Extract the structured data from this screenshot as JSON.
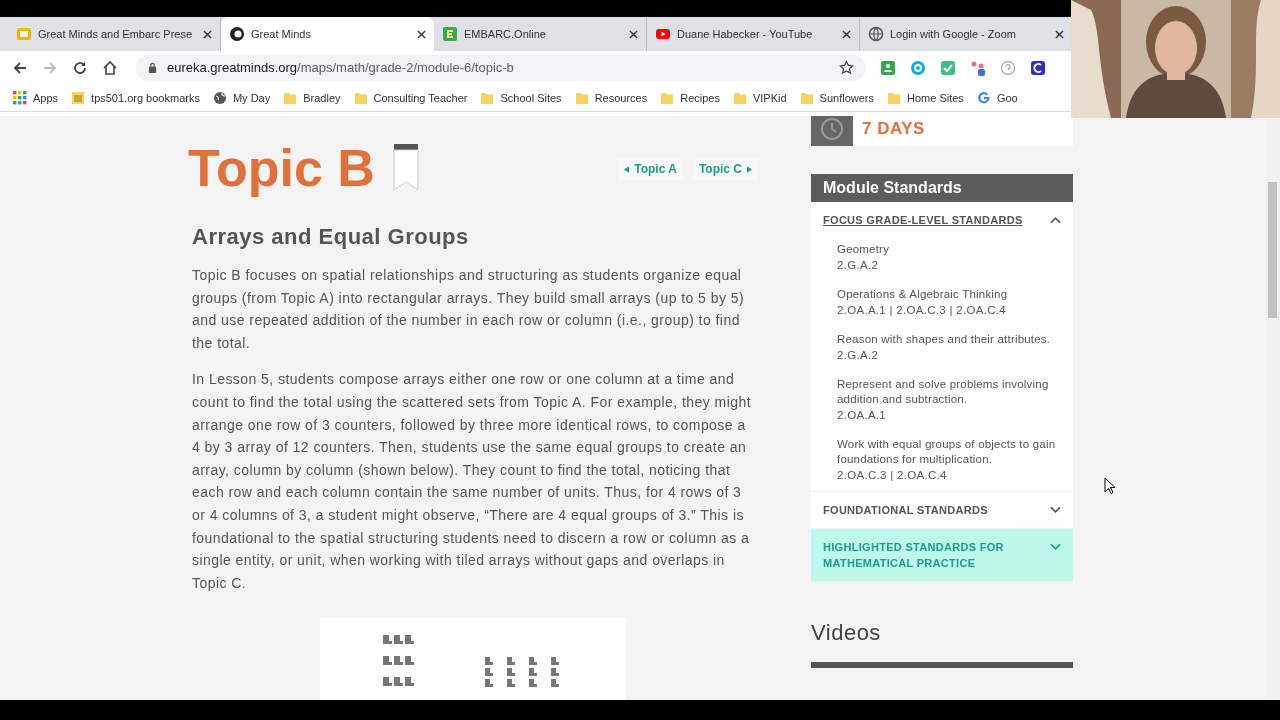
{
  "tabs": [
    {
      "title": "Great Minds and Embarc Prese",
      "kind": "slides",
      "selected": false
    },
    {
      "title": "Great Minds",
      "kind": "gm",
      "selected": true
    },
    {
      "title": "EMBARC.Online",
      "kind": "embarc",
      "selected": false
    },
    {
      "title": "Duane Habecker - YouTube",
      "kind": "youtube",
      "selected": false
    },
    {
      "title": "Login with Google - Zoom",
      "kind": "globe",
      "selected": false
    }
  ],
  "address_bar": {
    "host": "eureka.greatminds.org",
    "path": "/maps/math/grade-2/module-6/topic-b"
  },
  "bookmarks": [
    {
      "label": "Apps",
      "kind": "apps"
    },
    {
      "label": "tps501.org bookmarks",
      "kind": "page"
    },
    {
      "label": "My Day",
      "kind": "globe"
    },
    {
      "label": "Bradley",
      "kind": "folder"
    },
    {
      "label": "Consulting Teacher",
      "kind": "folder"
    },
    {
      "label": "School Sites",
      "kind": "folder"
    },
    {
      "label": "Resources",
      "kind": "folder"
    },
    {
      "label": "Recipes",
      "kind": "folder"
    },
    {
      "label": "VIPKid",
      "kind": "folder"
    },
    {
      "label": "Sunflowers",
      "kind": "folder"
    },
    {
      "label": "Home Sites",
      "kind": "folder"
    },
    {
      "label": "Goo",
      "kind": "google"
    }
  ],
  "page": {
    "title": "Topic B",
    "nav": [
      {
        "label": "Topic A",
        "kind": "prev"
      },
      {
        "label": "Topic C",
        "kind": "next"
      }
    ],
    "subtitle": "Arrays and Equal Groups",
    "paragraphs": [
      "Topic B focuses on spatial relationships and structuring as students organize equal groups (from Topic A) into rectangular arrays.  They build small arrays (up to 5 by 5) and use repeated addition of the number in each row or column (i.e., group) to find the total.",
      "In Lesson 5, students compose arrays either one row or one column at a time and count to find the total using the scattered sets from Topic A.  For example, they might arrange one row of 3 counters, followed by three more identical rows, to compose a 4 by 3 array of 12 counters.  Then, students use the same equal groups to create an array, column by column (shown below).  They count to find the total, noticing that each row and each column contain the same number of units.  Thus, for 4 rows of 3 or 4 columns of 3, a student might observe, “There are 4 equal groups of 3.”  This is foundational to the spatial structuring students need to discern a row or column as a single entity, or unit, when working with tiled arrays without gaps and overlaps in Topic C."
    ]
  },
  "sidebar": {
    "duration": "7 DAYS",
    "standards_title": "Module Standards",
    "sections": [
      {
        "title": "FOCUS GRADE-LEVEL STANDARDS",
        "expanded": true,
        "highlighted": false,
        "items": [
          {
            "name": "Geometry",
            "codes": "2.G.A.2"
          },
          {
            "name": "Operations & Algebraic Thinking",
            "codes": "2.OA.A.1 | 2.OA.C.3 | 2.OA.C.4"
          },
          {
            "name": "Reason with shapes and their attributes.",
            "codes": "2.G.A.2"
          },
          {
            "name": "Represent and solve problems involving addition and subtraction.",
            "codes": "2.OA.A.1"
          },
          {
            "name": "Work with equal groups of objects to gain foundations for multiplication.",
            "codes": "2.OA.C.3 | 2.OA.C.4"
          }
        ]
      },
      {
        "title": "FOUNDATIONAL STANDARDS",
        "expanded": false,
        "highlighted": false
      },
      {
        "title": "HIGHLIGHTED STANDARDS FOR MATHEMATICAL PRACTICE",
        "expanded": false,
        "highlighted": true
      }
    ],
    "videos_title": "Videos"
  }
}
